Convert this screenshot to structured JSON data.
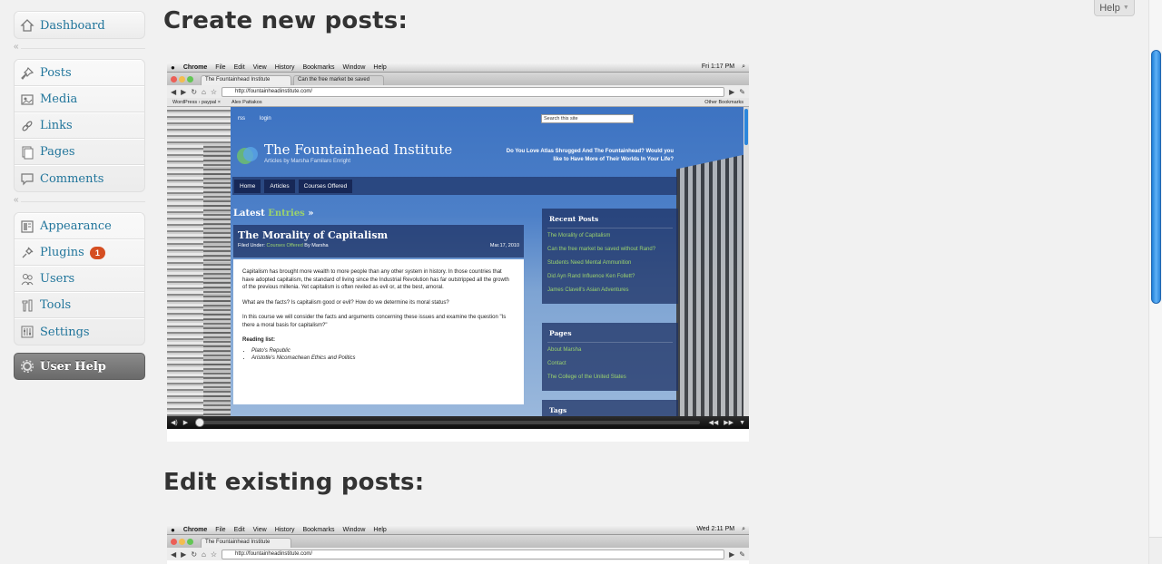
{
  "sidebar": {
    "dashboard": {
      "label": "Dashboard",
      "icon": "dashboard-icon"
    },
    "group1": [
      {
        "label": "Posts",
        "icon": "pushpin-icon"
      },
      {
        "label": "Media",
        "icon": "media-icon"
      },
      {
        "label": "Links",
        "icon": "link-icon"
      },
      {
        "label": "Pages",
        "icon": "pages-icon"
      },
      {
        "label": "Comments",
        "icon": "comment-icon"
      }
    ],
    "group2": [
      {
        "label": "Appearance",
        "icon": "appearance-icon"
      },
      {
        "label": "Plugins",
        "icon": "plugin-icon",
        "badge": "1"
      },
      {
        "label": "Users",
        "icon": "users-icon"
      },
      {
        "label": "Tools",
        "icon": "tools-icon"
      },
      {
        "label": "Settings",
        "icon": "settings-icon"
      }
    ],
    "user_help": {
      "label": "User Help",
      "icon": "gear-icon"
    },
    "collapse_glyph": "«"
  },
  "help_tab": {
    "label": "Help"
  },
  "headings": {
    "create": "Create new posts:",
    "edit": "Edit existing posts:"
  },
  "screenshot1": {
    "menubar": {
      "app": "Chrome",
      "items": [
        "File",
        "Edit",
        "View",
        "History",
        "Bookmarks",
        "Window",
        "Help"
      ],
      "clock": "Fri 1:17 PM"
    },
    "tabs": [
      "The Fountainhead Institute",
      "Can the free market be saved"
    ],
    "url": "http://fountainheadinstitute.com/",
    "bookmarks": [
      "WordPress › paypal ×",
      "Alex Pattakos"
    ],
    "other_bookmarks": "Other Bookmarks",
    "site": {
      "top_links": [
        "rss",
        "login"
      ],
      "search_placeholder": "Search this site",
      "title": "The Fountainhead Institute",
      "subtitle": "Articles by Marsha Familaro Enright",
      "tagline": "Do You Love Atlas Shrugged And The Fountainhead? Would you like to Have More of Their Worlds In Your Life?",
      "nav": [
        "Home",
        "Articles",
        "Courses Offered"
      ],
      "latest_prefix": "Latest",
      "latest_accent": "Entries",
      "latest_suffix": "»",
      "post_title": "The Morality of Capitalism",
      "post_filed_prefix": "Filed Under:",
      "post_category": "Courses Offered",
      "post_author": "By Marsha",
      "post_date": "Mar.17, 2010",
      "post_paragraphs": [
        "Capitalism has brought more wealth to more people than any other system in history. In those countries that have adopted capitalism, the standard of living since the Industrial Revolution has far outstripped all the growth of the previous millenia. Yet capitalism is often reviled as evil or, at the best, amoral.",
        "What are the facts? Is capitalism good or evil? How do we determine its moral status?",
        "In this course we will consider the facts and arguments concerning these issues and examine the question \"Is there a moral basis for capitalism?\""
      ],
      "reading_list_label": "Reading list:",
      "reading_list": [
        "Plato's Republic",
        "Aristotle's Nicomachean Ethics and Politics"
      ],
      "recent_posts_title": "Recent Posts",
      "recent_posts": [
        "The Morality of Capitalism",
        "Can the free market be saved without Rand?",
        "Students Need Mental Ammunition",
        "Did Ayn Rand Influence Ken Follett?",
        "James Clavell's Asian Adventures"
      ],
      "pages_title": "Pages",
      "pages": [
        "About Marsha",
        "Contact",
        "The College of the United States"
      ],
      "tags_title": "Tags"
    }
  },
  "screenshot2": {
    "menubar": {
      "app": "Chrome",
      "items": [
        "File",
        "Edit",
        "View",
        "History",
        "Bookmarks",
        "Window",
        "Help"
      ],
      "clock": "Wed 2:11 PM"
    },
    "tabs": [
      "The Fountainhead Institute"
    ],
    "url": "http://fountainheadinstitute.com/"
  }
}
